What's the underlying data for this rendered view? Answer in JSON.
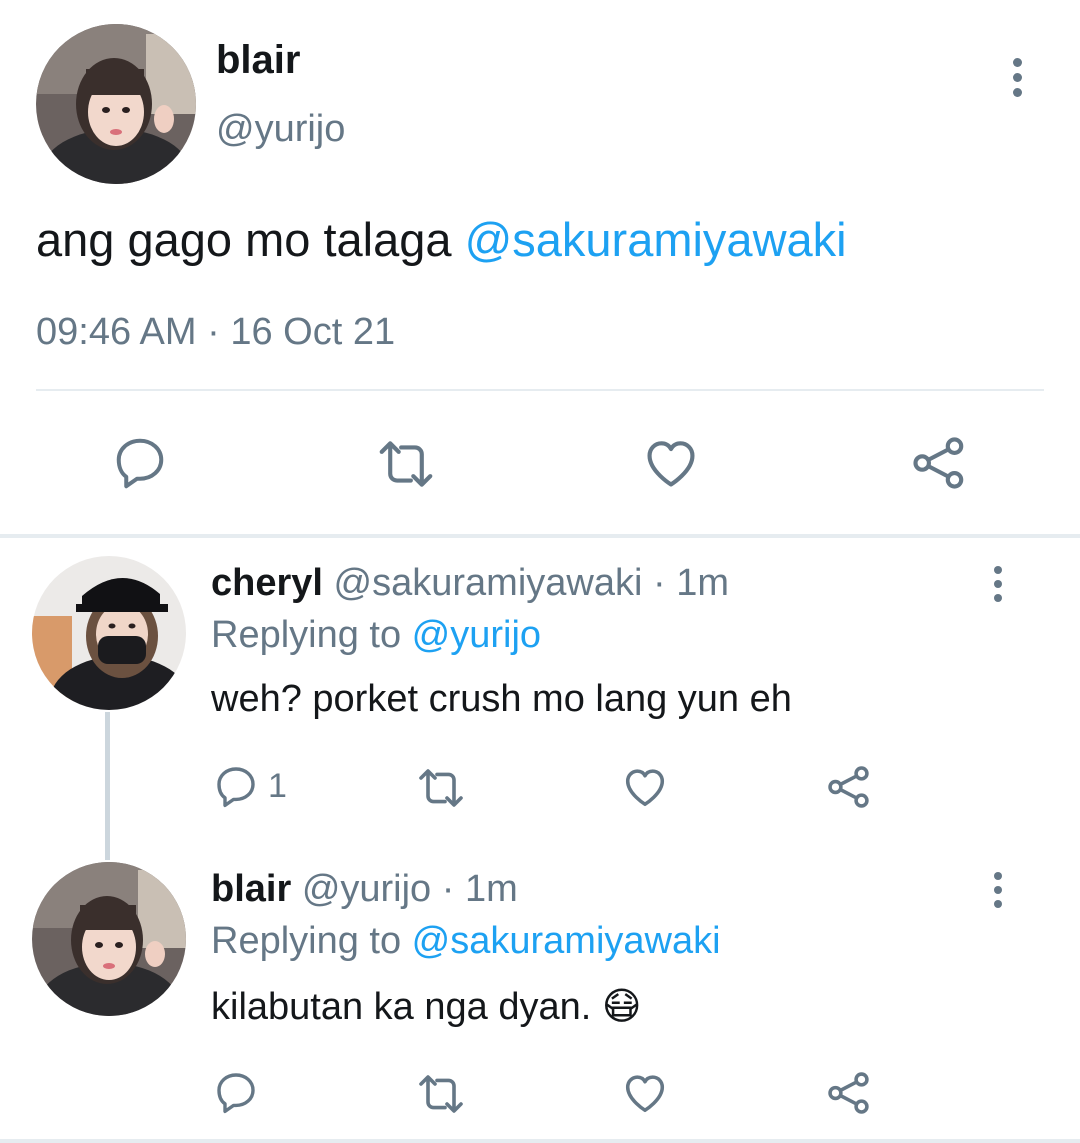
{
  "tweet": {
    "author_name": "blair",
    "author_handle": "@yurijo",
    "text_prefix": "ang gago mo talaga ",
    "text_mention": "@sakuramiyawaki",
    "timestamp": "09:46 AM · 16 Oct 21",
    "actions": [
      "reply-icon",
      "retweet-icon",
      "like-icon",
      "share-icon"
    ]
  },
  "replies": [
    {
      "author_name": "cheryl",
      "author_handle": "@sakuramiyawaki",
      "time_sep": " · ",
      "time": "1m",
      "replying_prefix": "Replying to ",
      "replying_to": "@yurijo",
      "text": "weh? porket crush mo lang yun eh",
      "reply_count": "1"
    },
    {
      "author_name": "blair",
      "author_handle": "@yurijo",
      "time_sep": " · ",
      "time": "1m",
      "replying_prefix": "Replying to ",
      "replying_to": "@sakuramiyawaki",
      "text": "kilabutan ka nga dyan. ",
      "emoji": "😷",
      "reply_count": ""
    }
  ],
  "colors": {
    "text": "#14171a",
    "secondary": "#657786",
    "accent": "#1da1f2",
    "divider": "#e6ecf0"
  }
}
